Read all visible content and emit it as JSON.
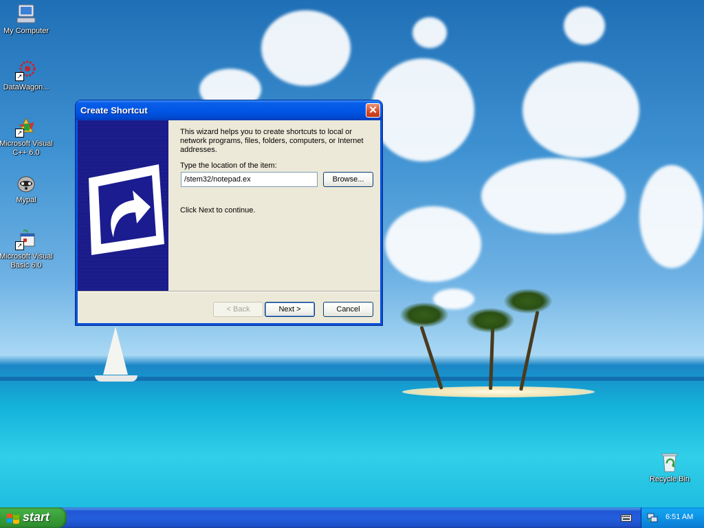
{
  "desktop": {
    "icons": [
      {
        "label": "My Computer",
        "icon": "my-computer-icon"
      },
      {
        "label": "DataWagon...",
        "icon": "datawagon-icon"
      },
      {
        "label": "Microsoft Visual C++ 6.0",
        "icon": "visual-cpp-icon"
      },
      {
        "label": "Mypal",
        "icon": "mypal-icon"
      },
      {
        "label": "Microsoft Visual Basic 6.0",
        "icon": "visual-basic-icon"
      },
      {
        "label": "Recycle Bin",
        "icon": "recycle-bin-icon"
      }
    ]
  },
  "dialog": {
    "title": "Create Shortcut",
    "close_glyph": "✕",
    "intro": "This wizard helps you to create shortcuts to local or network programs, files, folders, computers, or Internet addresses.",
    "location_label": "Type the location of the item:",
    "location_value": "/stem32/notepad.ex",
    "browse_label": "Browse...",
    "continue_text": "Click Next to continue.",
    "back_label": "< Back",
    "next_label": "Next >",
    "cancel_label": "Cancel"
  },
  "taskbar": {
    "start_label": "start",
    "clock": "6:51 AM"
  },
  "colors": {
    "title_bar": "#0058e6",
    "dialog_face": "#ece9d8",
    "wizard_panel": "#1c1d8c",
    "start_green": "#379c37",
    "taskbar_blue": "#245edb"
  }
}
